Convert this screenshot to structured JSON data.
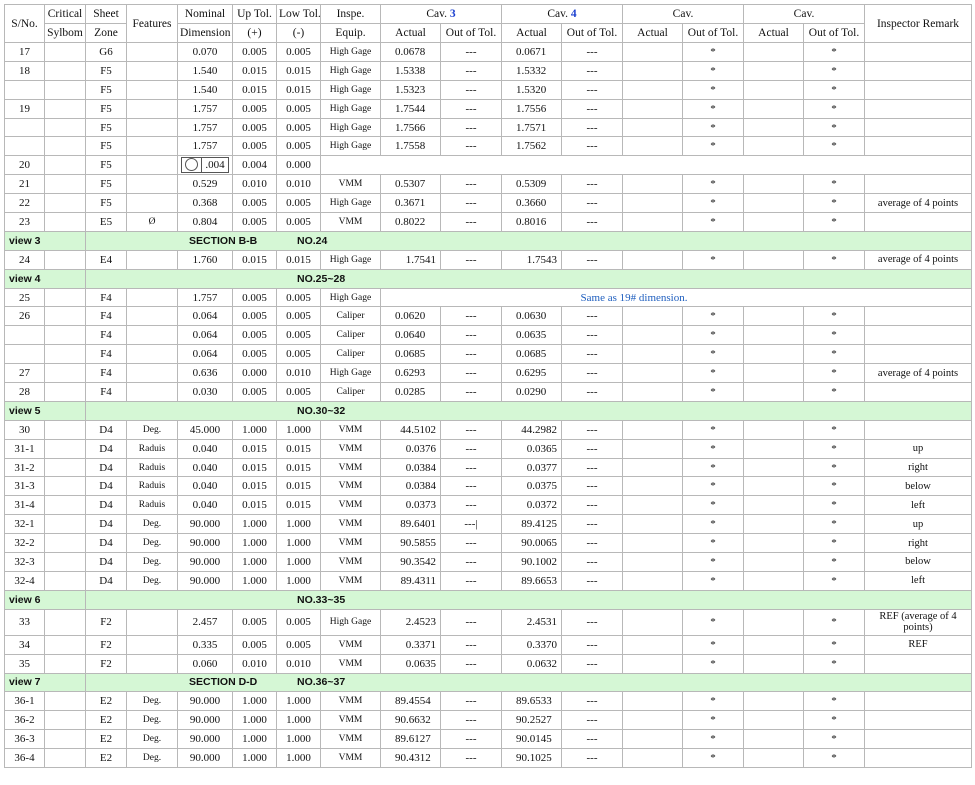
{
  "header": {
    "row1": [
      "S/No.",
      "Critical",
      "Sheet",
      "Features",
      "Nominal",
      "Up Tol.",
      "Low Tol.",
      "Inspe.",
      "Cav.",
      "",
      "Cav.",
      "",
      "Cav.",
      "",
      "Cav.",
      "",
      "Inspector Remark"
    ],
    "row2": [
      "Sylbom",
      "Zone",
      "Dimension",
      "(+)",
      "(-)",
      "Equip.",
      "Actual",
      "Out of Tol.",
      "Actual",
      "Out of Tol.",
      "Actual",
      "Out of Tol.",
      "Actual",
      "Out of Tol."
    ],
    "cav3_num": "3",
    "cav4_num": "4"
  },
  "rows": [
    {
      "type": "data",
      "sno": "17",
      "crit": "",
      "zone": "G6",
      "feat": "",
      "nom": "0.070",
      "up": "0.005",
      "low": "0.005",
      "eq": "High Gage",
      "a3": "0.0678",
      "o3": "---",
      "a4": "0.0671",
      "o4": "---",
      "o5": "*",
      "o7": "*",
      "rem": ""
    },
    {
      "type": "data",
      "sno": "18",
      "crit": "",
      "zone": "F5",
      "feat": "",
      "nom": "1.540",
      "up": "0.015",
      "low": "0.015",
      "eq": "High Gage",
      "a3": "1.5338",
      "o3": "---",
      "a4": "1.5332",
      "o4": "---",
      "o5": "*",
      "o7": "*",
      "rem": ""
    },
    {
      "type": "data",
      "sno": "",
      "crit": "",
      "zone": "F5",
      "feat": "",
      "nom": "1.540",
      "up": "0.015",
      "low": "0.015",
      "eq": "High Gage",
      "a3": "1.5323",
      "o3": "---",
      "a4": "1.5320",
      "o4": "---",
      "o5": "*",
      "o7": "*",
      "rem": ""
    },
    {
      "type": "data",
      "sno": "19",
      "crit": "",
      "zone": "F5",
      "feat": "",
      "nom": "1.757",
      "up": "0.005",
      "low": "0.005",
      "eq": "High Gage",
      "a3": "1.7544",
      "o3": "---",
      "a4": "1.7556",
      "o4": "---",
      "o5": "*",
      "o7": "*",
      "rem": ""
    },
    {
      "type": "data",
      "sno": "",
      "crit": "",
      "zone": "F5",
      "feat": "",
      "nom": "1.757",
      "up": "0.005",
      "low": "0.005",
      "eq": "High Gage",
      "a3": "1.7566",
      "o3": "---",
      "a4": "1.7571",
      "o4": "---",
      "o5": "*",
      "o7": "*",
      "rem": ""
    },
    {
      "type": "data",
      "sno": "",
      "crit": "",
      "zone": "F5",
      "feat": "",
      "nom": "1.757",
      "up": "0.005",
      "low": "0.005",
      "eq": "High Gage",
      "a3": "1.7558",
      "o3": "---",
      "a4": "1.7562",
      "o4": "---",
      "o5": "*",
      "o7": "*",
      "rem": ""
    },
    {
      "type": "fcf",
      "sno": "20",
      "zone": "F5",
      "fcf_value": ".004",
      "up": "0.004",
      "low": "0.000"
    },
    {
      "type": "data",
      "sno": "21",
      "crit": "",
      "zone": "F5",
      "feat": "",
      "nom": "0.529",
      "up": "0.010",
      "low": "0.010",
      "eq": "VMM",
      "a3": "0.5307",
      "o3": "---",
      "a4": "0.5309",
      "o4": "---",
      "o5": "*",
      "o7": "*",
      "rem": ""
    },
    {
      "type": "data",
      "sno": "22",
      "crit": "",
      "zone": "F5",
      "feat": "",
      "nom": "0.368",
      "up": "0.005",
      "low": "0.005",
      "eq": "High Gage",
      "a3": "0.3671",
      "o3": "---",
      "a4": "0.3660",
      "o4": "---",
      "o5": "*",
      "o7": "*",
      "rem": "average of 4 points"
    },
    {
      "type": "data",
      "sno": "23",
      "crit": "",
      "zone": "E5",
      "feat": "Ø",
      "nom": "0.804",
      "up": "0.005",
      "low": "0.005",
      "eq": "VMM",
      "a3": "0.8022",
      "o3": "---",
      "a4": "0.8016",
      "o4": "---",
      "o5": "*",
      "o7": "*",
      "rem": ""
    },
    {
      "type": "view",
      "label": "view 3",
      "section": "SECTION B-B",
      "nos": "NO.24"
    },
    {
      "type": "data",
      "sno": "24",
      "crit": "",
      "zone": "E4",
      "feat": "",
      "nom": "1.760",
      "up": "0.015",
      "low": "0.015",
      "eq": "High Gage",
      "a3": "1.7541",
      "o3": "---",
      "a4": "1.7543",
      "o4": "---",
      "o5": "*",
      "o7": "*",
      "rem": "average of 4 points",
      "align": "right"
    },
    {
      "type": "view",
      "label": "view 4",
      "section": "",
      "nos": "NO.25~28"
    },
    {
      "type": "same",
      "sno": "25",
      "zone": "F4",
      "nom": "1.757",
      "up": "0.005",
      "low": "0.005",
      "eq": "High Gage",
      "note": "Same as 19# dimension."
    },
    {
      "type": "data",
      "sno": "26",
      "crit": "",
      "zone": "F4",
      "feat": "",
      "nom": "0.064",
      "up": "0.005",
      "low": "0.005",
      "eq": "Caliper",
      "a3": "0.0620",
      "o3": "---",
      "a4": "0.0630",
      "o4": "---",
      "o5": "*",
      "o7": "*",
      "rem": ""
    },
    {
      "type": "data",
      "sno": "",
      "crit": "",
      "zone": "F4",
      "feat": "",
      "nom": "0.064",
      "up": "0.005",
      "low": "0.005",
      "eq": "Caliper",
      "a3": "0.0640",
      "o3": "---",
      "a4": "0.0635",
      "o4": "---",
      "o5": "*",
      "o7": "*",
      "rem": ""
    },
    {
      "type": "data",
      "sno": "",
      "crit": "",
      "zone": "F4",
      "feat": "",
      "nom": "0.064",
      "up": "0.005",
      "low": "0.005",
      "eq": "Caliper",
      "a3": "0.0685",
      "o3": "---",
      "a4": "0.0685",
      "o4": "---",
      "o5": "*",
      "o7": "*",
      "rem": ""
    },
    {
      "type": "data",
      "sno": "27",
      "crit": "",
      "zone": "F4",
      "feat": "",
      "nom": "0.636",
      "up": "0.000",
      "low": "0.010",
      "eq": "High Gage",
      "a3": "0.6293",
      "o3": "---",
      "a4": "0.6295",
      "o4": "---",
      "o5": "*",
      "o7": "*",
      "rem": "average of 4 points"
    },
    {
      "type": "data",
      "sno": "28",
      "crit": "",
      "zone": "F4",
      "feat": "",
      "nom": "0.030",
      "up": "0.005",
      "low": "0.005",
      "eq": "Caliper",
      "a3": "0.0285",
      "o3": "---",
      "a4": "0.0290",
      "o4": "---",
      "o5": "*",
      "o7": "*",
      "rem": ""
    },
    {
      "type": "view",
      "label": "view 5",
      "section": "",
      "nos": "NO.30~32"
    },
    {
      "type": "data",
      "sno": "30",
      "crit": "",
      "zone": "D4",
      "feat": "Deg.",
      "nom": "45.000",
      "up": "1.000",
      "low": "1.000",
      "eq": "VMM",
      "a3": "44.5102",
      "o3": "---",
      "a4": "44.2982",
      "o4": "---",
      "o5": "*",
      "o7": "*",
      "rem": "",
      "align": "right"
    },
    {
      "type": "data",
      "sno": "31-1",
      "crit": "",
      "zone": "D4",
      "feat": "Raduis",
      "nom": "0.040",
      "up": "0.015",
      "low": "0.015",
      "eq": "VMM",
      "a3": "0.0376",
      "o3": "---",
      "a4": "0.0365",
      "o4": "---",
      "o5": "*",
      "o7": "*",
      "rem": "up",
      "align": "right"
    },
    {
      "type": "data",
      "sno": "31-2",
      "crit": "",
      "zone": "D4",
      "feat": "Raduis",
      "nom": "0.040",
      "up": "0.015",
      "low": "0.015",
      "eq": "VMM",
      "a3": "0.0384",
      "o3": "---",
      "a4": "0.0377",
      "o4": "---",
      "o5": "*",
      "o7": "*",
      "rem": "right",
      "align": "right"
    },
    {
      "type": "data",
      "sno": "31-3",
      "crit": "",
      "zone": "D4",
      "feat": "Raduis",
      "nom": "0.040",
      "up": "0.015",
      "low": "0.015",
      "eq": "VMM",
      "a3": "0.0384",
      "o3": "---",
      "a4": "0.0375",
      "o4": "---",
      "o5": "*",
      "o7": "*",
      "rem": "below",
      "align": "right"
    },
    {
      "type": "data",
      "sno": "31-4",
      "crit": "",
      "zone": "D4",
      "feat": "Raduis",
      "nom": "0.040",
      "up": "0.015",
      "low": "0.015",
      "eq": "VMM",
      "a3": "0.0373",
      "o3": "---",
      "a4": "0.0372",
      "o4": "---",
      "o5": "*",
      "o7": "*",
      "rem": "left",
      "align": "right"
    },
    {
      "type": "data",
      "sno": "32-1",
      "crit": "",
      "zone": "D4",
      "feat": "Deg.",
      "nom": "90.000",
      "up": "1.000",
      "low": "1.000",
      "eq": "VMM",
      "a3": "89.6401",
      "o3": "---|",
      "a4": "89.4125",
      "o4": "---",
      "o5": "*",
      "o7": "*",
      "rem": "up",
      "align": "right"
    },
    {
      "type": "data",
      "sno": "32-2",
      "crit": "",
      "zone": "D4",
      "feat": "Deg.",
      "nom": "90.000",
      "up": "1.000",
      "low": "1.000",
      "eq": "VMM",
      "a3": "90.5855",
      "o3": "---",
      "a4": "90.0065",
      "o4": "---",
      "o5": "*",
      "o7": "*",
      "rem": "right",
      "align": "right"
    },
    {
      "type": "data",
      "sno": "32-3",
      "crit": "",
      "zone": "D4",
      "feat": "Deg.",
      "nom": "90.000",
      "up": "1.000",
      "low": "1.000",
      "eq": "VMM",
      "a3": "90.3542",
      "o3": "---",
      "a4": "90.1002",
      "o4": "---",
      "o5": "*",
      "o7": "*",
      "rem": "below",
      "align": "right"
    },
    {
      "type": "data",
      "sno": "32-4",
      "crit": "",
      "zone": "D4",
      "feat": "Deg.",
      "nom": "90.000",
      "up": "1.000",
      "low": "1.000",
      "eq": "VMM",
      "a3": "89.4311",
      "o3": "---",
      "a4": "89.6653",
      "o4": "---",
      "o5": "*",
      "o7": "*",
      "rem": "left",
      "align": "right"
    },
    {
      "type": "view",
      "label": "view 6",
      "section": "",
      "nos": "NO.33~35"
    },
    {
      "type": "data",
      "sno": "33",
      "crit": "",
      "zone": "F2",
      "feat": "",
      "nom": "2.457",
      "up": "0.005",
      "low": "0.005",
      "eq": "High Gage",
      "a3": "2.4523",
      "o3": "---",
      "a4": "2.4531",
      "o4": "---",
      "o5": "*",
      "o7": "*",
      "rem": "REF (average of 4 points)",
      "align": "right",
      "tall": true
    },
    {
      "type": "data",
      "sno": "34",
      "crit": "",
      "zone": "F2",
      "feat": "",
      "nom": "0.335",
      "up": "0.005",
      "low": "0.005",
      "eq": "VMM",
      "a3": "0.3371",
      "o3": "---",
      "a4": "0.3370",
      "o4": "---",
      "o5": "*",
      "o7": "*",
      "rem": "REF",
      "align": "right"
    },
    {
      "type": "data",
      "sno": "35",
      "crit": "",
      "zone": "F2",
      "feat": "",
      "nom": "0.060",
      "up": "0.010",
      "low": "0.010",
      "eq": "VMM",
      "a3": "0.0635",
      "o3": "---",
      "a4": "0.0632",
      "o4": "---",
      "o5": "*",
      "o7": "*",
      "rem": "",
      "align": "right"
    },
    {
      "type": "view",
      "label": "view 7",
      "section": "SECTION D-D",
      "nos": "NO.36~37"
    },
    {
      "type": "data",
      "sno": "36-1",
      "crit": "",
      "zone": "E2",
      "feat": "Deg.",
      "nom": "90.000",
      "up": "1.000",
      "low": "1.000",
      "eq": "VMM",
      "a3": "89.4554",
      "o3": "---",
      "a4": "89.6533",
      "o4": "---",
      "o5": "*",
      "o7": "*",
      "rem": ""
    },
    {
      "type": "data",
      "sno": "36-2",
      "crit": "",
      "zone": "E2",
      "feat": "Deg.",
      "nom": "90.000",
      "up": "1.000",
      "low": "1.000",
      "eq": "VMM",
      "a3": "90.6632",
      "o3": "---",
      "a4": "90.2527",
      "o4": "---",
      "o5": "*",
      "o7": "*",
      "rem": ""
    },
    {
      "type": "data",
      "sno": "36-3",
      "crit": "",
      "zone": "E2",
      "feat": "Deg.",
      "nom": "90.000",
      "up": "1.000",
      "low": "1.000",
      "eq": "VMM",
      "a3": "89.6127",
      "o3": "---",
      "a4": "90.0145",
      "o4": "---",
      "o5": "*",
      "o7": "*",
      "rem": ""
    },
    {
      "type": "data",
      "sno": "36-4",
      "crit": "",
      "zone": "E2",
      "feat": "Deg.",
      "nom": "90.000",
      "up": "1.000",
      "low": "1.000",
      "eq": "VMM",
      "a3": "90.4312",
      "o3": "---",
      "a4": "90.1025",
      "o4": "---",
      "o5": "*",
      "o7": "*",
      "rem": ""
    }
  ]
}
